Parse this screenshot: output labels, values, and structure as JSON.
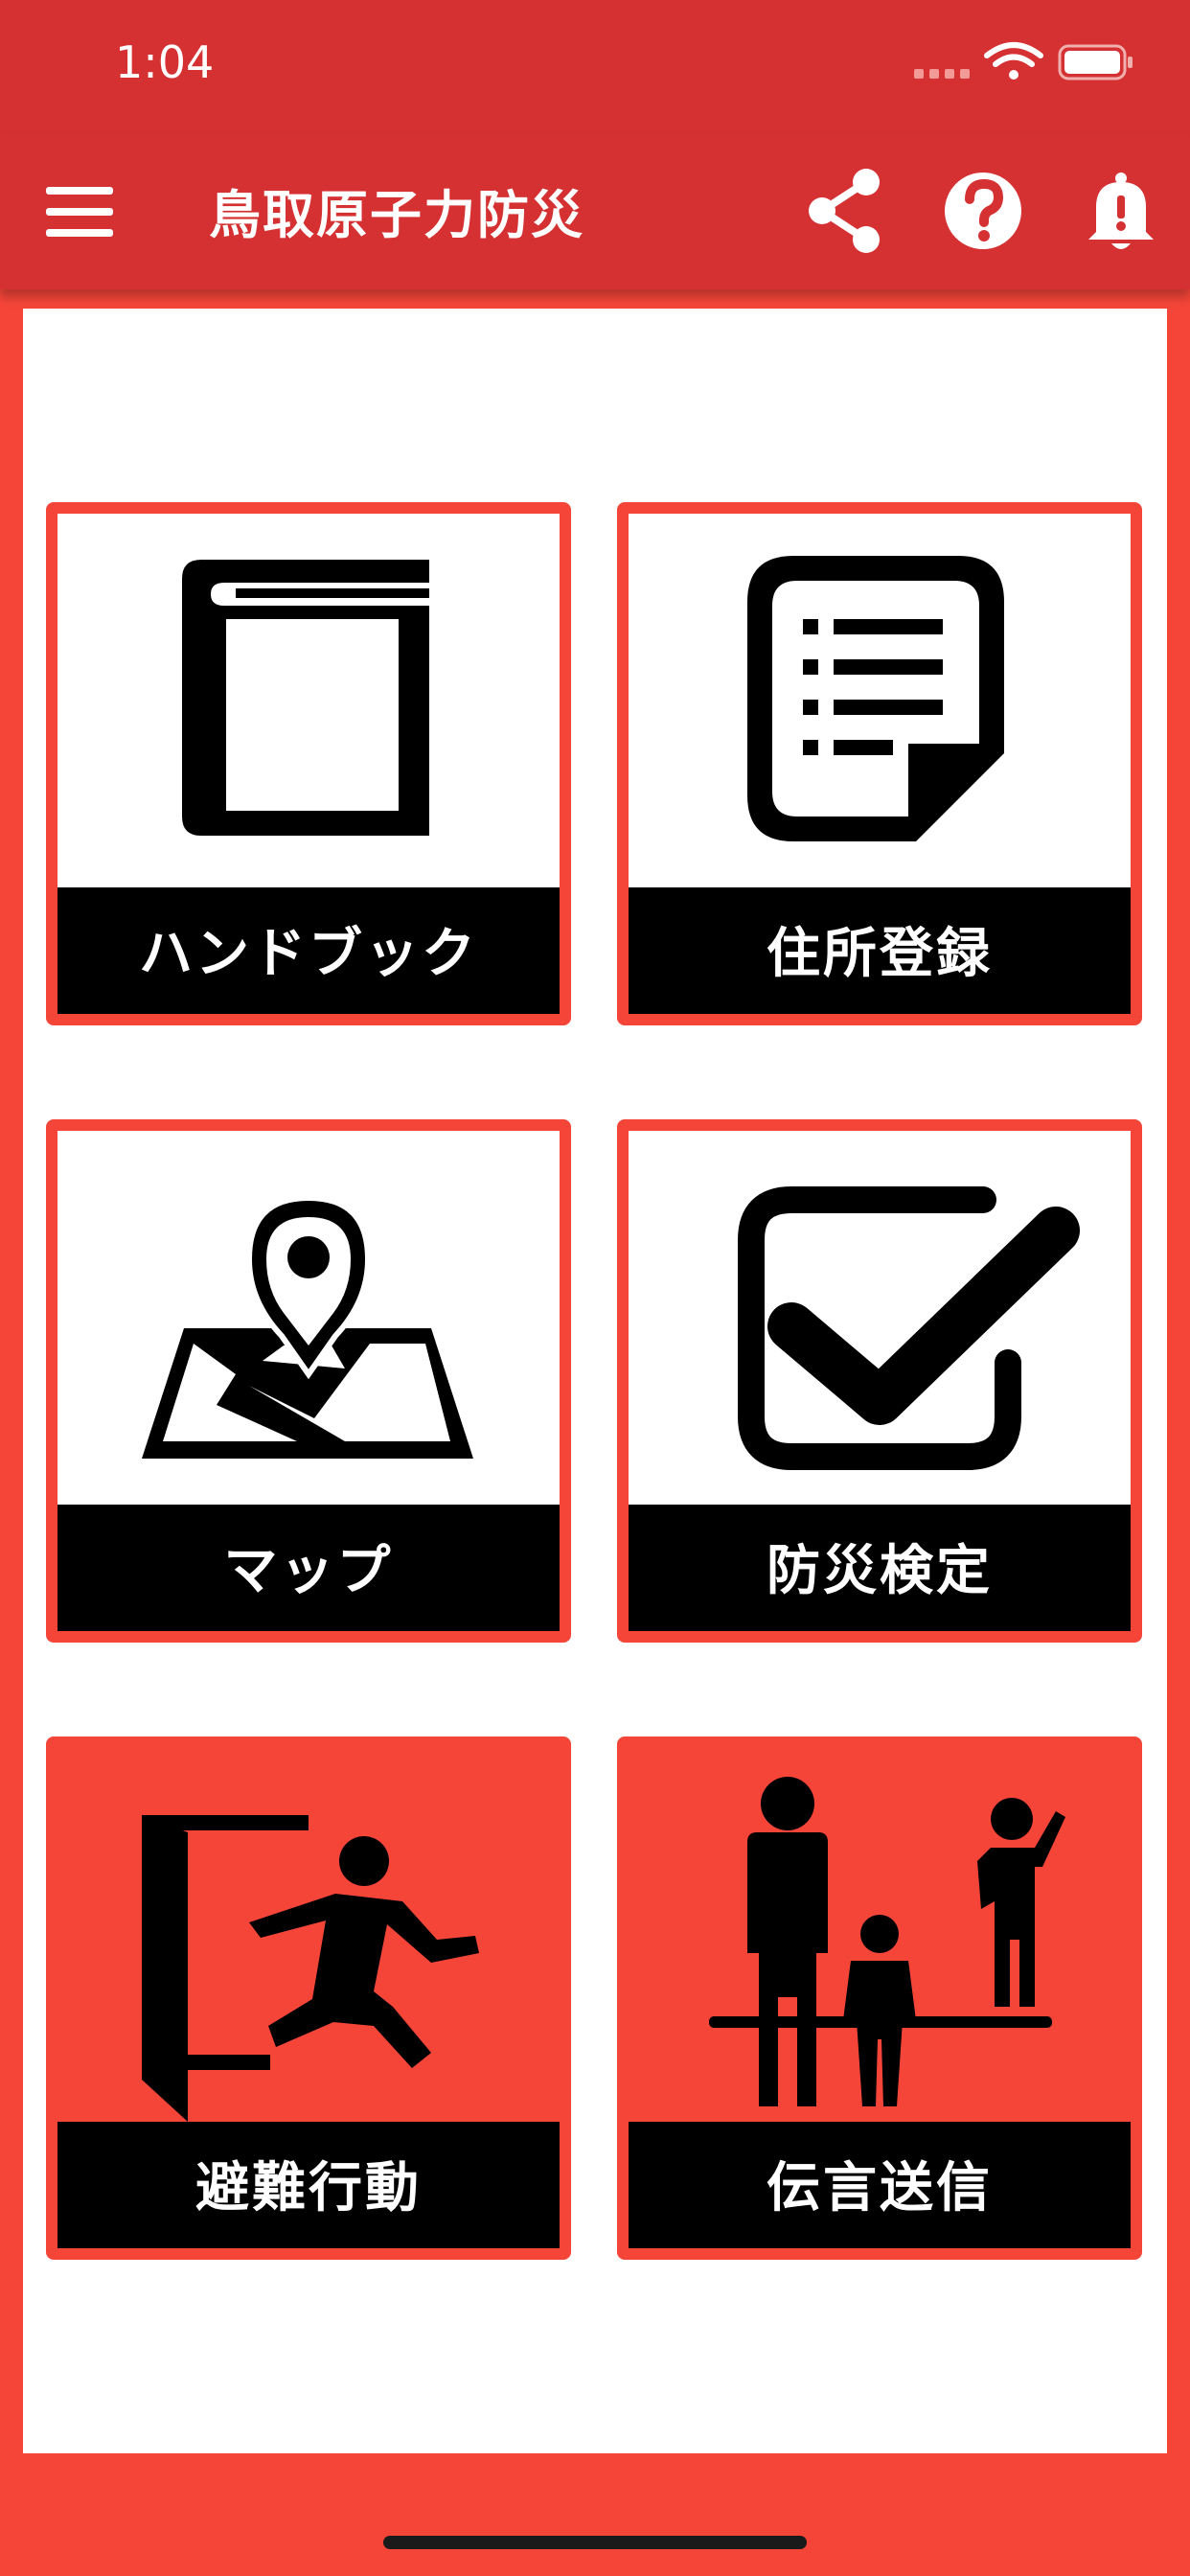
{
  "status_bar": {
    "time": "1:04"
  },
  "header": {
    "title": "鳥取原子力防災",
    "icons": [
      "hamburger-menu-icon",
      "share-icon",
      "help-icon",
      "bell-icon"
    ]
  },
  "tiles": [
    {
      "label": "ハンドブック",
      "icon": "book-icon",
      "style": "white"
    },
    {
      "label": "住所登録",
      "icon": "document-list-icon",
      "style": "white"
    },
    {
      "label": "マップ",
      "icon": "map-pin-icon",
      "style": "white"
    },
    {
      "label": "防災検定",
      "icon": "checkbox-check-icon",
      "style": "white"
    },
    {
      "label": "避難行動",
      "icon": "running-exit-icon",
      "style": "red"
    },
    {
      "label": "伝言送信",
      "icon": "family-icon",
      "style": "red"
    }
  ],
  "colors": {
    "header_red": "#d53132",
    "accent_red": "#f54538",
    "label_bg": "#000000",
    "text_white": "#ffffff"
  }
}
